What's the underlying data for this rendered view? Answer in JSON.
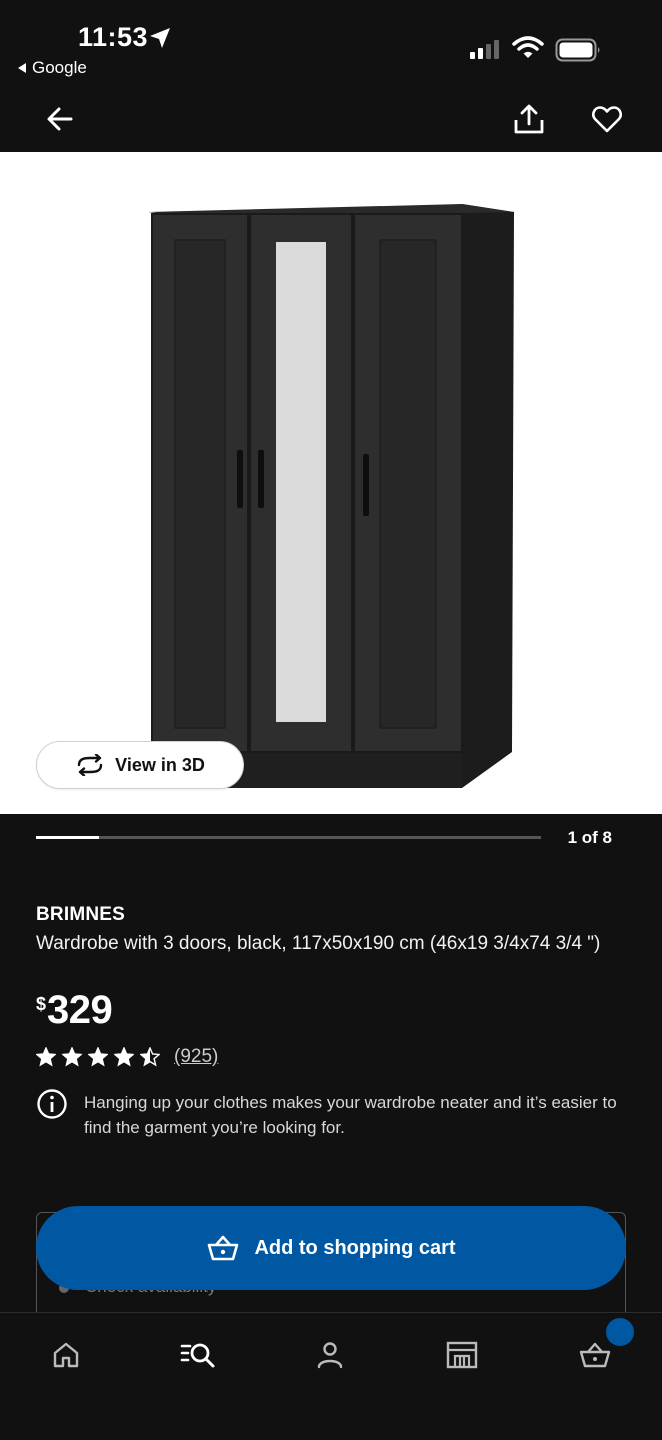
{
  "status_bar": {
    "time": "11:53",
    "back_app": "Google",
    "icons": [
      "location-arrow-icon",
      "signal-icon",
      "wifi-icon",
      "battery-icon"
    ]
  },
  "app_bar": {
    "icons": [
      "back-arrow-icon",
      "share-icon",
      "heart-icon"
    ]
  },
  "gallery": {
    "view3d_label": "View in 3D",
    "counter": "1 of 8",
    "progress": 0.125
  },
  "product": {
    "brand": "BRIMNES",
    "description": "Wardrobe with 3 doors, black, 117x50x190 cm (46x19 3/4x74 3/4 \")",
    "currency": "$",
    "price": "329",
    "rating": 4.5,
    "reviews": "(925)",
    "info": "Hanging up your clothes makes your wardrobe neater and it’s easier to find the garment you’re looking for."
  },
  "actions": {
    "add_to_cart": "Add to shopping cart",
    "stock_text": "Check availability"
  },
  "bottom_nav": {
    "items": [
      "home-icon",
      "search-icon",
      "profile-icon",
      "store-icon",
      "cart-icon"
    ]
  },
  "colors": {
    "accent": "#0058a3",
    "background": "#111112"
  }
}
